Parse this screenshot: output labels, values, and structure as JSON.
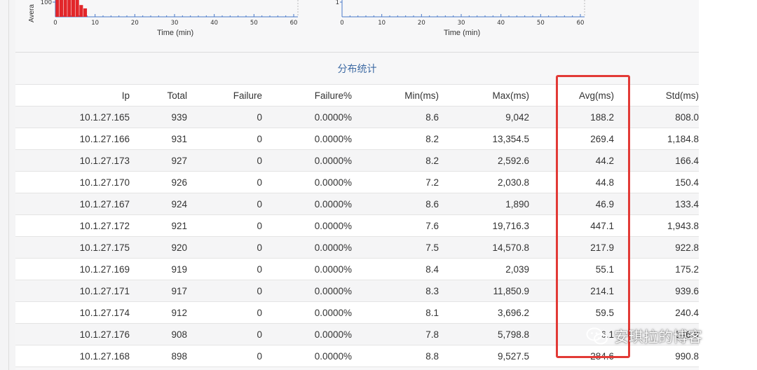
{
  "colors": {
    "accent_title": "#3d6aa3",
    "highlight_border": "#e23a36",
    "bar_red": "#e2262a",
    "axis_blue": "#4a78c8"
  },
  "charts": [
    {
      "y_label": "Avera",
      "y_tick_top": "100",
      "x_title": "Time (min)",
      "x_ticks": [
        "0",
        "10",
        "20",
        "30",
        "40",
        "50",
        "60"
      ],
      "x_range": [
        0,
        60
      ],
      "bars": [
        {
          "x": 0.5,
          "y": 1.0
        },
        {
          "x": 1.5,
          "y": 1.0
        },
        {
          "x": 2.5,
          "y": 1.0
        },
        {
          "x": 3.5,
          "y": 1.0
        },
        {
          "x": 4.5,
          "y": 1.0
        },
        {
          "x": 5.5,
          "y": 1.0
        },
        {
          "x": 6.5,
          "y": 0.7
        },
        {
          "x": 7.5,
          "y": 0.5
        }
      ]
    },
    {
      "y_label": "",
      "y_tick_top": "1",
      "x_title": "Time (min)",
      "x_ticks": [
        "0",
        "10",
        "20",
        "30",
        "40",
        "50",
        "60"
      ],
      "x_range": [
        0,
        60
      ],
      "bars": []
    }
  ],
  "section_title": "分布统计",
  "table": {
    "headers": [
      "Ip",
      "Total",
      "Failure",
      "Failure%",
      "Min(ms)",
      "Max(ms)",
      "Avg(ms)",
      "Std(ms)"
    ],
    "rows": [
      [
        "10.1.27.165",
        "939",
        "0",
        "0.0000%",
        "8.6",
        "9,042",
        "188.2",
        "808.0"
      ],
      [
        "10.1.27.166",
        "931",
        "0",
        "0.0000%",
        "8.2",
        "13,354.5",
        "269.4",
        "1,184.8"
      ],
      [
        "10.1.27.173",
        "927",
        "0",
        "0.0000%",
        "8.2",
        "2,592.6",
        "44.2",
        "166.4"
      ],
      [
        "10.1.27.170",
        "926",
        "0",
        "0.0000%",
        "7.2",
        "2,030.8",
        "44.8",
        "150.4"
      ],
      [
        "10.1.27.167",
        "924",
        "0",
        "0.0000%",
        "8.6",
        "1,890",
        "46.9",
        "133.4"
      ],
      [
        "10.1.27.172",
        "921",
        "0",
        "0.0000%",
        "7.6",
        "19,716.3",
        "447.1",
        "1,943.8"
      ],
      [
        "10.1.27.175",
        "920",
        "0",
        "0.0000%",
        "7.5",
        "14,570.8",
        "217.9",
        "922.8"
      ],
      [
        "10.1.27.169",
        "919",
        "0",
        "0.0000%",
        "8.4",
        "2,039",
        "55.1",
        "175.2"
      ],
      [
        "10.1.27.171",
        "917",
        "0",
        "0.0000%",
        "8.3",
        "11,850.9",
        "214.1",
        "939.6"
      ],
      [
        "10.1.27.174",
        "912",
        "0",
        "0.0000%",
        "8.1",
        "3,696.2",
        "59.5",
        "240.4"
      ],
      [
        "10.1.27.176",
        "908",
        "0",
        "0.0000%",
        "7.8",
        "5,798.8",
        "6.1",
        "546.9"
      ],
      [
        "10.1.27.168",
        "898",
        "0",
        "0.0000%",
        "8.8",
        "9,527.5",
        "284.6",
        "990.8"
      ]
    ]
  },
  "watermark": {
    "icon": "wechat-icon",
    "text": "安琪拉的博客"
  }
}
